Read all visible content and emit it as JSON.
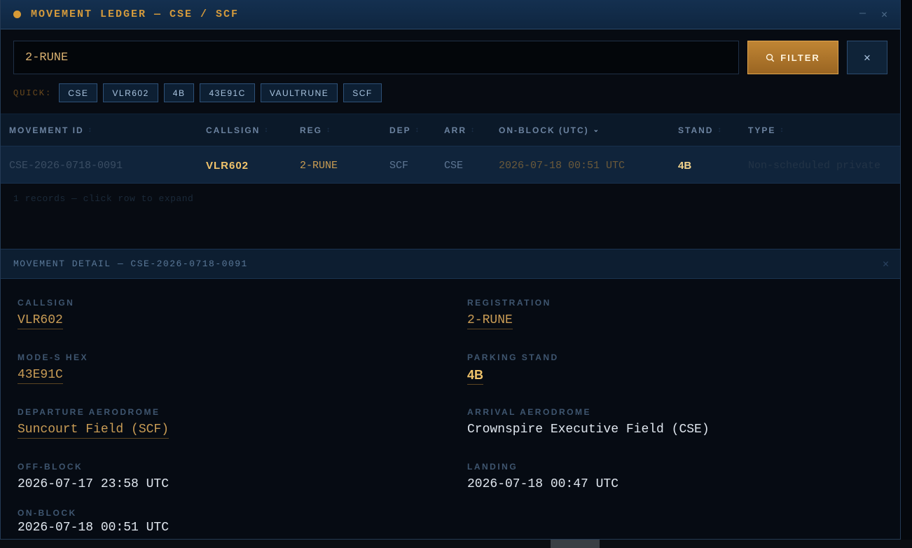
{
  "window": {
    "title": "MOVEMENT LEDGER — CSE / SCF",
    "minimize_icon": "—",
    "close_icon": "✕"
  },
  "search": {
    "value": "2-RUNE",
    "filter_label": "FILTER",
    "clear_label": "✕"
  },
  "quick": {
    "label": "QUICK:",
    "chips": [
      "CSE",
      "VLR602",
      "4B",
      "43E91C",
      "VAULTRUNE",
      "SCF"
    ]
  },
  "table": {
    "headers": {
      "id": "MOVEMENT ID",
      "callsign": "CALLSIGN",
      "reg": "REG",
      "dep": "DEP",
      "arr": "ARR",
      "onblock": "ON-BLOCK (UTC)",
      "stand": "STAND",
      "type": "TYPE"
    },
    "rows": [
      {
        "id": "CSE-2026-0718-0091",
        "callsign": "VLR602",
        "reg": "2-RUNE",
        "dep": "SCF",
        "arr": "CSE",
        "onblock": "2026-07-18 00:51 UTC",
        "stand": "4B",
        "type": "Non-scheduled private"
      }
    ],
    "records_text": "1 records — click row to expand"
  },
  "detail": {
    "title": "MOVEMENT DETAIL — CSE-2026-0718-0091",
    "close_icon": "✕",
    "fields": {
      "callsign": {
        "label": "CALLSIGN",
        "value": "VLR602"
      },
      "registration": {
        "label": "REGISTRATION",
        "value": "2-RUNE"
      },
      "modes": {
        "label": "MODE-S HEX",
        "value": "43E91C"
      },
      "stand": {
        "label": "PARKING STAND",
        "value": "4B"
      },
      "departure": {
        "label": "DEPARTURE AERODROME",
        "value": "Suncourt Field (SCF)"
      },
      "arrival": {
        "label": "ARRIVAL AERODROME",
        "value": "Crownspire Executive Field (CSE)"
      },
      "offblock": {
        "label": "OFF-BLOCK",
        "value": "2026-07-17 23:58 UTC"
      },
      "landing": {
        "label": "LANDING",
        "value": "2026-07-18 00:47 UTC"
      },
      "onblock": {
        "label": "ON-BLOCK",
        "value": "2026-07-18 00:51 UTC"
      }
    }
  }
}
